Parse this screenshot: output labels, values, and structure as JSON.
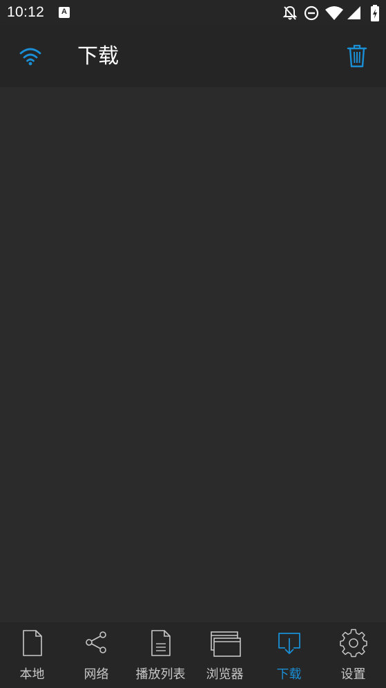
{
  "status_bar": {
    "time": "10:12",
    "icons": [
      "app-notification-icon",
      "notifications-off-icon",
      "do-not-disturb-icon",
      "wifi-signal-icon",
      "cell-signal-icon",
      "battery-charging-icon"
    ]
  },
  "app_bar": {
    "title": "下载",
    "left_icon": "wifi-icon",
    "right_icon": "trash-icon"
  },
  "bottom_nav": {
    "items": [
      {
        "label": "本地",
        "icon": "file-icon"
      },
      {
        "label": "网络",
        "icon": "share-icon"
      },
      {
        "label": "播放列表",
        "icon": "document-list-icon"
      },
      {
        "label": "浏览器",
        "icon": "browser-window-icon"
      },
      {
        "label": "下载",
        "icon": "download-icon",
        "active": true
      },
      {
        "label": "设置",
        "icon": "gear-icon"
      }
    ]
  },
  "colors": {
    "accent": "#1a8fd6",
    "background": "#2b2b2b",
    "bar": "#252525",
    "nav_label": "#c8c8c8"
  }
}
